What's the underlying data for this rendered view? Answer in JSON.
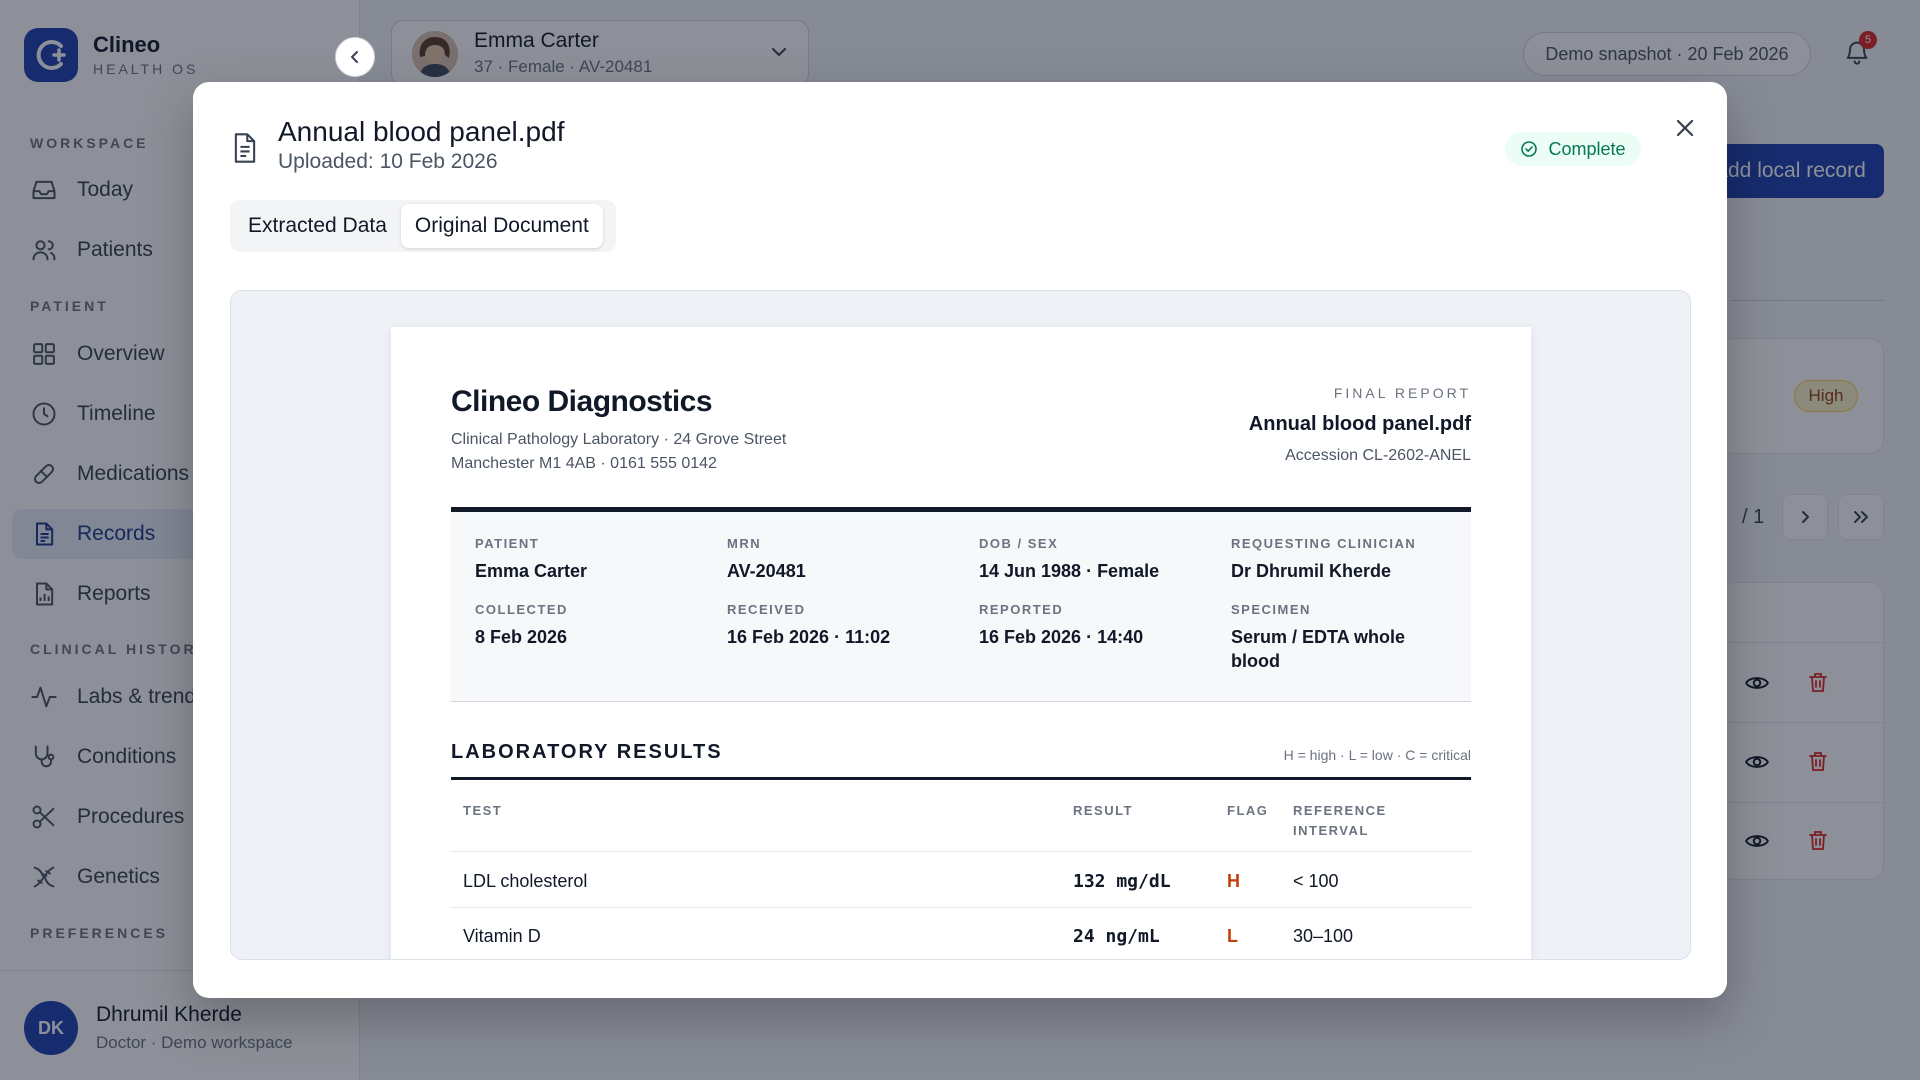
{
  "app": {
    "name": "Clineo",
    "subtitle": "HEALTH OS"
  },
  "sidebar": {
    "sections": {
      "workspace": "WORKSPACE",
      "patient": "PATIENT",
      "clinical_history": "CLINICAL HISTORY",
      "preferences": "PREFERENCES"
    },
    "items": [
      {
        "label": "Today",
        "icon": "inbox-icon"
      },
      {
        "label": "Patients",
        "icon": "users-icon"
      },
      {
        "label": "Overview",
        "icon": "grid-icon"
      },
      {
        "label": "Timeline",
        "icon": "clock-icon"
      },
      {
        "label": "Medications",
        "icon": "pill-icon"
      },
      {
        "label": "Records",
        "icon": "document-icon",
        "active": true
      },
      {
        "label": "Reports",
        "icon": "report-icon"
      },
      {
        "label": "Labs & trends",
        "icon": "activity-icon"
      },
      {
        "label": "Conditions",
        "icon": "stethoscope-icon"
      },
      {
        "label": "Procedures",
        "icon": "scissors-icon"
      },
      {
        "label": "Genetics",
        "icon": "dna-icon"
      }
    ],
    "user": {
      "initials": "DK",
      "name": "Dhrumil Kherde",
      "role": "Doctor · Demo workspace"
    }
  },
  "header": {
    "patient": {
      "name": "Emma Carter",
      "meta": "37 · Female · AV-20481"
    },
    "snapshot": "Demo snapshot · 20 Feb 2026",
    "notifications": "5"
  },
  "background": {
    "add_button": "Add local record",
    "severity_badge": "High",
    "pager": "/ 1"
  },
  "modal": {
    "title": "Annual blood panel.pdf",
    "uploaded": "Uploaded: 10 Feb 2026",
    "status": "Complete",
    "tabs": [
      {
        "label": "Extracted Data",
        "active": false
      },
      {
        "label": "Original Document",
        "active": true
      }
    ]
  },
  "report": {
    "lab_name": "Clineo Diagnostics",
    "address_line1": "Clinical Pathology Laboratory · 24 Grove Street",
    "address_line2": "Manchester M1 4AB · 0161 555 0142",
    "report_type": "FINAL REPORT",
    "file_name": "Annual blood panel.pdf",
    "accession": "Accession CL-2602-ANEL",
    "info": [
      {
        "label": "PATIENT",
        "value": "Emma Carter"
      },
      {
        "label": "MRN",
        "value": "AV-20481"
      },
      {
        "label": "DOB / SEX",
        "value": "14 Jun 1988 · Female"
      },
      {
        "label": "REQUESTING CLINICIAN",
        "value": "Dr Dhrumil Kherde"
      },
      {
        "label": "COLLECTED",
        "value": "8 Feb 2026"
      },
      {
        "label": "RECEIVED",
        "value": "16 Feb 2026 · 11:02"
      },
      {
        "label": "REPORTED",
        "value": "16 Feb 2026 · 14:40"
      },
      {
        "label": "SPECIMEN",
        "value": "Serum / EDTA whole blood"
      }
    ],
    "results_title": "LABORATORY RESULTS",
    "legend": "H = high · L = low · C = critical",
    "columns": {
      "test": "TEST",
      "result": "RESULT",
      "flag": "FLAG",
      "reference": "REFERENCE INTERVAL"
    },
    "rows": [
      {
        "test": "LDL cholesterol",
        "result": "132 mg/dL",
        "flag": "H",
        "reference": "< 100"
      },
      {
        "test": "Vitamin D",
        "result": "24 ng/mL",
        "flag": "L",
        "reference": "30–100"
      }
    ]
  }
}
